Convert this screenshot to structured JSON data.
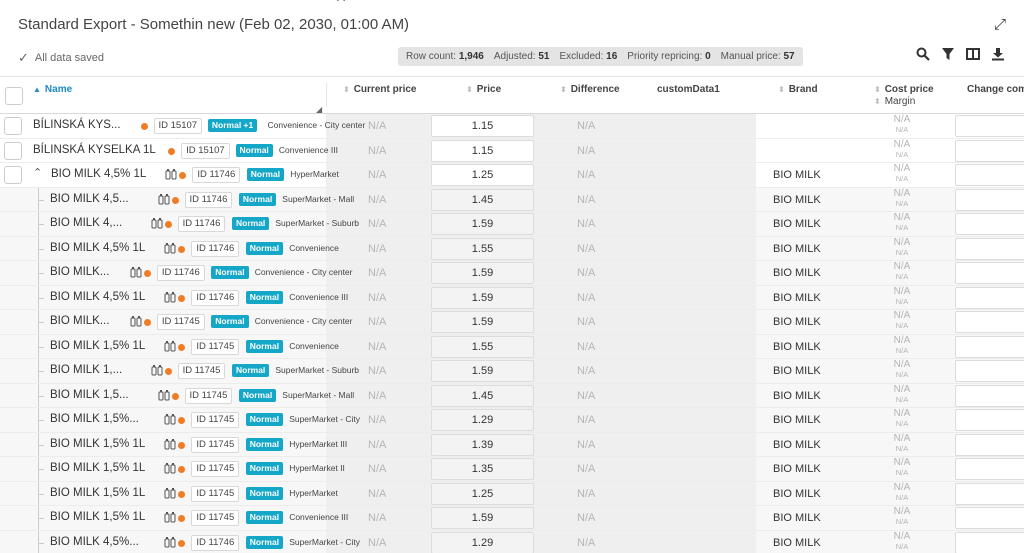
{
  "header": {
    "title": "Standard Export - Somethin new (Feb 02, 2030, 01:00 AM)",
    "saved_text": "All data saved",
    "stats": [
      {
        "label": "Row count:",
        "value": "1,946"
      },
      {
        "label": "Adjusted:",
        "value": "51"
      },
      {
        "label": "Excluded:",
        "value": "16"
      },
      {
        "label": "Priority repricing:",
        "value": "0"
      },
      {
        "label": "Manual price:",
        "value": "57"
      }
    ]
  },
  "columns": {
    "name": "Name",
    "current_price": "Current price",
    "price": "Price",
    "difference": "Difference",
    "custom": "customData1",
    "brand": "Brand",
    "cost_price": "Cost price",
    "margin": "Margin",
    "change": "Change comm"
  },
  "na": "N/A",
  "rows": [
    {
      "name": "BÍLINSKÁ KYS...",
      "icon": false,
      "dot": true,
      "id": "ID 15107",
      "badge": "Normal +1",
      "store": "Convenience - City center",
      "price": "1.15",
      "brand": "",
      "child": false,
      "check": true,
      "chev": false
    },
    {
      "name": "BÍLINSKÁ KYSELKA 1L",
      "icon": false,
      "dot": true,
      "id": "ID 15107",
      "badge": "Normal",
      "store": "Convenience III",
      "price": "1.15",
      "brand": "",
      "child": false,
      "check": true,
      "chev": false
    },
    {
      "name": "BIO MILK 4,5% 1L",
      "icon": true,
      "dot": true,
      "id": "ID 11746",
      "badge": "Normal",
      "store": "HyperMarket",
      "price": "1.25",
      "brand": "BIO MILK",
      "child": false,
      "check": true,
      "chev": true
    },
    {
      "name": "BIO MILK 4,5...",
      "icon": true,
      "dot": true,
      "id": "ID 11746",
      "badge": "Normal",
      "store": "SuperMarket - Mall",
      "price": "1.45",
      "brand": "BIO MILK",
      "child": true
    },
    {
      "name": "BIO MILK 4,...",
      "icon": true,
      "dot": true,
      "id": "ID 11746",
      "badge": "Normal",
      "store": "SuperMarket - Suburb",
      "price": "1.59",
      "brand": "BIO MILK",
      "child": true
    },
    {
      "name": "BIO MILK 4,5% 1L",
      "icon": true,
      "dot": true,
      "id": "ID 11746",
      "badge": "Normal",
      "store": "Convenience",
      "price": "1.55",
      "brand": "BIO MILK",
      "child": true
    },
    {
      "name": "BIO MILK...",
      "icon": true,
      "dot": true,
      "id": "ID 11746",
      "badge": "Normal",
      "store": "Convenience - City center",
      "price": "1.59",
      "brand": "BIO MILK",
      "child": true
    },
    {
      "name": "BIO MILK 4,5% 1L",
      "icon": true,
      "dot": true,
      "id": "ID 11746",
      "badge": "Normal",
      "store": "Convenience III",
      "price": "1.59",
      "brand": "BIO MILK",
      "child": true
    },
    {
      "name": "BIO MILK...",
      "icon": true,
      "dot": true,
      "id": "ID 11745",
      "badge": "Normal",
      "store": "Convenience - City center",
      "price": "1.59",
      "brand": "BIO MILK",
      "child": true
    },
    {
      "name": "BIO MILK 1,5% 1L",
      "icon": true,
      "dot": true,
      "id": "ID 11745",
      "badge": "Normal",
      "store": "Convenience",
      "price": "1.55",
      "brand": "BIO MILK",
      "child": true
    },
    {
      "name": "BIO MILK 1,...",
      "icon": true,
      "dot": true,
      "id": "ID 11745",
      "badge": "Normal",
      "store": "SuperMarket - Suburb",
      "price": "1.59",
      "brand": "BIO MILK",
      "child": true
    },
    {
      "name": "BIO MILK 1,5...",
      "icon": true,
      "dot": true,
      "id": "ID 11745",
      "badge": "Normal",
      "store": "SuperMarket - Mall",
      "price": "1.45",
      "brand": "BIO MILK",
      "child": true
    },
    {
      "name": "BIO MILK 1,5%...",
      "icon": true,
      "dot": true,
      "id": "ID 11745",
      "badge": "Normal",
      "store": "SuperMarket - City",
      "price": "1.29",
      "brand": "BIO MILK",
      "child": true
    },
    {
      "name": "BIO MILK 1,5% 1L",
      "icon": true,
      "dot": true,
      "id": "ID 11745",
      "badge": "Normal",
      "store": "HyperMarket III",
      "price": "1.39",
      "brand": "BIO MILK",
      "child": true
    },
    {
      "name": "BIO MILK 1,5% 1L",
      "icon": true,
      "dot": true,
      "id": "ID 11745",
      "badge": "Normal",
      "store": "HyperMarket II",
      "price": "1.35",
      "brand": "BIO MILK",
      "child": true
    },
    {
      "name": "BIO MILK 1,5% 1L",
      "icon": true,
      "dot": true,
      "id": "ID 11745",
      "badge": "Normal",
      "store": "HyperMarket",
      "price": "1.25",
      "brand": "BIO MILK",
      "child": true
    },
    {
      "name": "BIO MILK 1,5% 1L",
      "icon": true,
      "dot": true,
      "id": "ID 11745",
      "badge": "Normal",
      "store": "Convenience III",
      "price": "1.59",
      "brand": "BIO MILK",
      "child": true
    },
    {
      "name": "BIO MILK 4,5%...",
      "icon": true,
      "dot": true,
      "id": "ID 11746",
      "badge": "Normal",
      "store": "SuperMarket - City",
      "price": "1.29",
      "brand": "BIO MILK",
      "child": true
    }
  ]
}
